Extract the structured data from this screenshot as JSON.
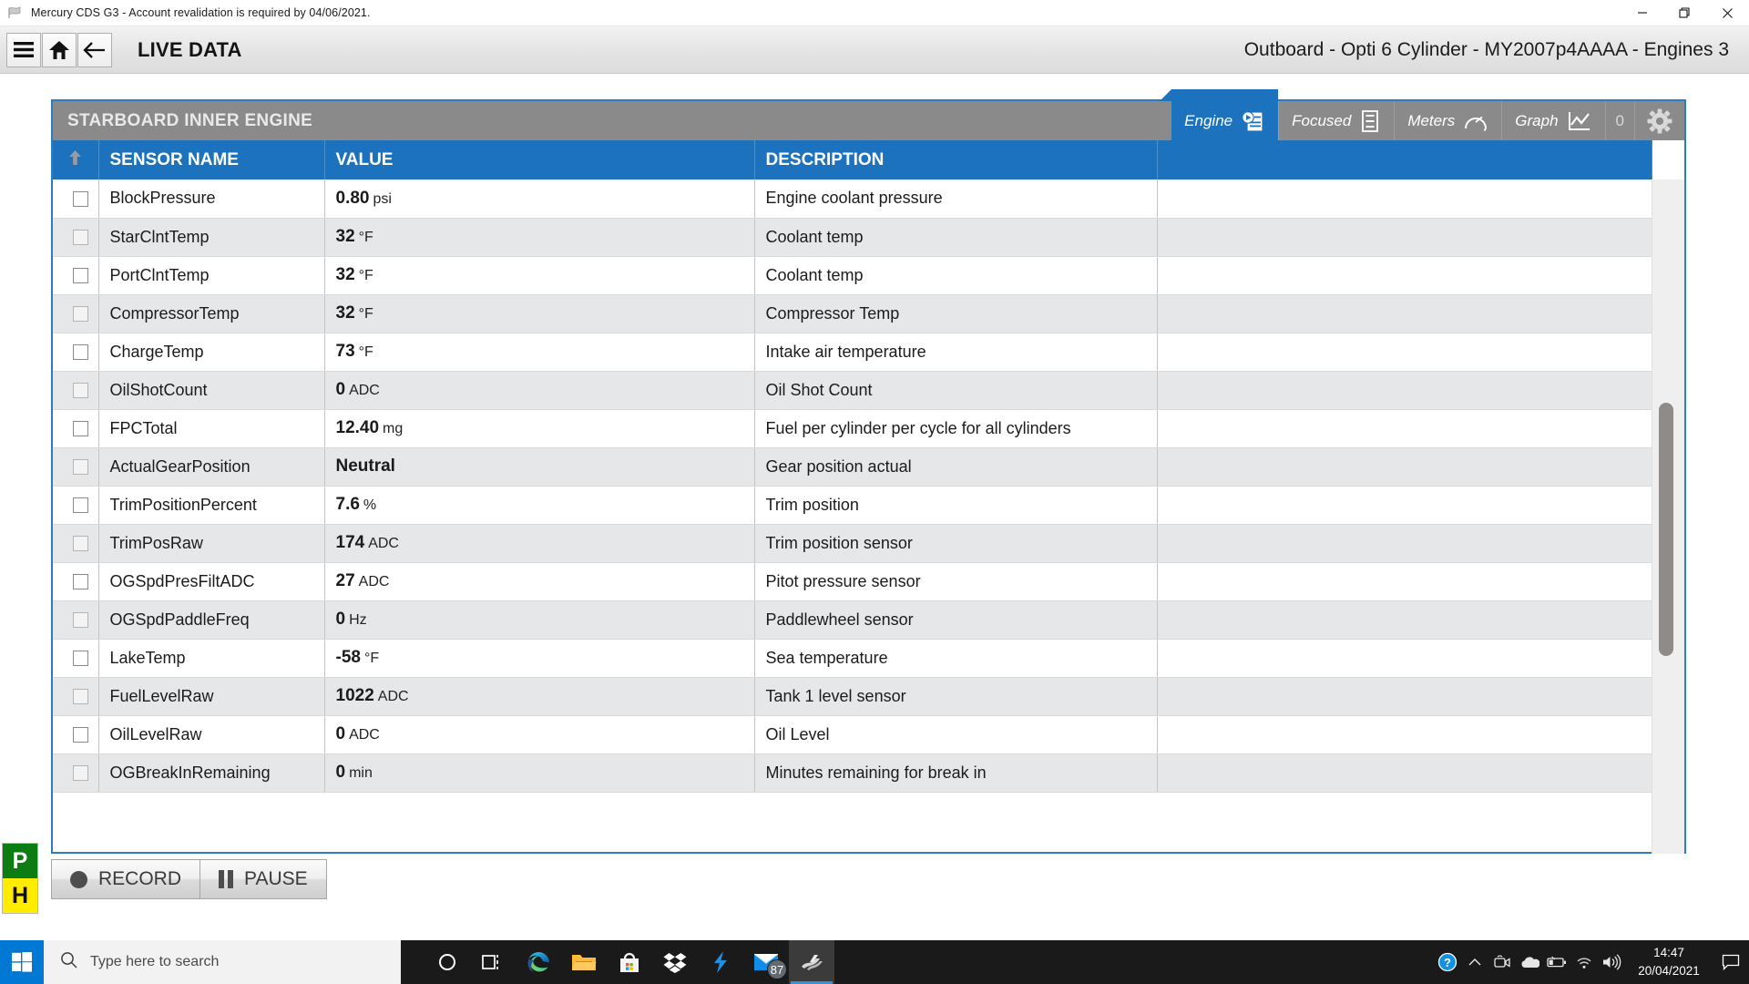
{
  "window": {
    "title": "Mercury CDS G3 - Account revalidation is required by 04/06/2021.",
    "icon": "mercury-flag-icon",
    "minimize_label": "Minimize",
    "restore_label": "Restore",
    "close_label": "Close"
  },
  "header": {
    "menu_icon": "hamburger-menu-icon",
    "home_icon": "home-icon",
    "back_icon": "back-arrow-icon",
    "page_title": "LIVE DATA",
    "engine_context": "Outboard - Opti 6 Cylinder - MY2007p4AAAA - Engines 3"
  },
  "panel": {
    "engine_name": "STARBOARD INNER ENGINE",
    "tabs": [
      {
        "label": "Engine",
        "icon": "engine-list-icon",
        "active": true
      },
      {
        "label": "Focused",
        "icon": "focused-list-icon",
        "active": false
      },
      {
        "label": "Meters",
        "icon": "gauge-icon",
        "active": false
      },
      {
        "label": "Graph",
        "icon": "line-chart-icon",
        "active": false
      }
    ],
    "tab_count": "0",
    "settings_icon": "gear-icon"
  },
  "table": {
    "sort_indicator": "sort-ascending-arrow-icon",
    "columns": [
      "",
      "SENSOR NAME",
      "VALUE",
      "DESCRIPTION",
      ""
    ],
    "rows": [
      {
        "name": "BlockPressure",
        "value": "0.80",
        "unit": "psi",
        "description": "Engine coolant pressure"
      },
      {
        "name": "StarClntTemp",
        "value": "32",
        "unit": "°F",
        "description": "Coolant temp"
      },
      {
        "name": "PortClntTemp",
        "value": "32",
        "unit": "°F",
        "description": "Coolant temp"
      },
      {
        "name": "CompressorTemp",
        "value": "32",
        "unit": "°F",
        "description": "Compressor Temp"
      },
      {
        "name": "ChargeTemp",
        "value": "73",
        "unit": "°F",
        "description": "Intake air temperature"
      },
      {
        "name": "OilShotCount",
        "value": "0",
        "unit": "ADC",
        "description": "Oil Shot Count"
      },
      {
        "name": "FPCTotal",
        "value": "12.40",
        "unit": "mg",
        "description": "Fuel per cylinder per cycle for all cylinders"
      },
      {
        "name": "ActualGearPosition",
        "value": "Neutral",
        "unit": "",
        "description": "Gear position actual"
      },
      {
        "name": "TrimPositionPercent",
        "value": "7.6",
        "unit": "%",
        "description": "Trim position"
      },
      {
        "name": "TrimPosRaw",
        "value": "174",
        "unit": "ADC",
        "description": "Trim position sensor"
      },
      {
        "name": "OGSpdPresFiltADC",
        "value": "27",
        "unit": "ADC",
        "description": "Pitot pressure sensor"
      },
      {
        "name": "OGSpdPaddleFreq",
        "value": "0",
        "unit": "Hz",
        "description": "Paddlewheel sensor"
      },
      {
        "name": "LakeTemp",
        "value": "-58",
        "unit": "°F",
        "description": "Sea temperature"
      },
      {
        "name": "FuelLevelRaw",
        "value": "1022",
        "unit": "ADC",
        "description": "Tank 1 level sensor"
      },
      {
        "name": "OilLevelRaw",
        "value": "0",
        "unit": "ADC",
        "description": "Oil Level"
      },
      {
        "name": "OGBreakInRemaining",
        "value": "0",
        "unit": "min",
        "description": "Minutes remaining for break in"
      }
    ]
  },
  "controls": {
    "record_label": "RECORD",
    "record_icon": "record-dot-icon",
    "pause_label": "PAUSE",
    "pause_icon": "pause-bars-icon"
  },
  "badges": {
    "position_label": "P",
    "position_color": "#0c7d12",
    "helm_label": "H",
    "helm_color": "#ffec00"
  },
  "taskbar": {
    "start_icon": "windows-start-icon",
    "search_icon": "search-icon",
    "search_placeholder": "Type here to search",
    "items": [
      {
        "icon": "cortana-circle-icon",
        "name": "cortana",
        "active": false
      },
      {
        "icon": "task-view-icon",
        "name": "task-view",
        "active": false
      },
      {
        "icon": "edge-browser-icon",
        "name": "edge",
        "active": false
      },
      {
        "icon": "file-explorer-icon",
        "name": "file-explorer",
        "active": false
      },
      {
        "icon": "microsoft-store-icon",
        "name": "store",
        "active": false
      },
      {
        "icon": "dropbox-icon",
        "name": "dropbox",
        "active": false
      },
      {
        "icon": "lightning-bolt-icon",
        "name": "bolt-app",
        "active": false
      },
      {
        "icon": "mail-icon",
        "name": "mail",
        "active": false,
        "badge": "87"
      },
      {
        "icon": "mercury-cds-icon",
        "name": "mercury-cds",
        "active": true
      }
    ],
    "tray": [
      {
        "icon": "help-circle-icon",
        "name": "help"
      },
      {
        "icon": "chevron-up-icon",
        "name": "show-hidden-icons"
      },
      {
        "icon": "camera-icon",
        "name": "camera"
      },
      {
        "icon": "onedrive-icon",
        "name": "onedrive"
      },
      {
        "icon": "battery-icon",
        "name": "battery"
      },
      {
        "icon": "wifi-icon",
        "name": "network"
      },
      {
        "icon": "speaker-icon",
        "name": "volume"
      }
    ],
    "clock_time": "14:47",
    "clock_date": "20/04/2021",
    "action_center_icon": "action-center-icon"
  }
}
